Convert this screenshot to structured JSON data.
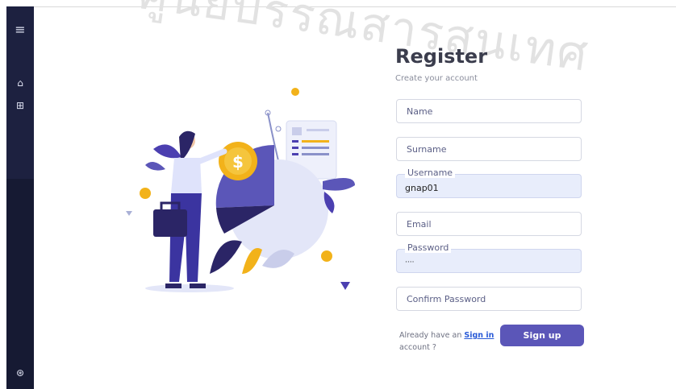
{
  "watermark": "ศูนย์บรรณสารสนเทศ",
  "sidebar": {
    "menu_icon": "≡",
    "home_icon": "⌂",
    "apps_icon": "⊞",
    "user_icon": "⊛"
  },
  "form": {
    "title": "Register",
    "subtitle": "Create your account",
    "name": {
      "placeholder": "Name",
      "value": ""
    },
    "surname": {
      "placeholder": "Surname",
      "value": ""
    },
    "username": {
      "label": "Username",
      "value": "gnap01"
    },
    "email": {
      "placeholder": "Email",
      "value": ""
    },
    "password": {
      "label": "Password",
      "value": "····"
    },
    "confirm_password": {
      "placeholder": "Confirm Password",
      "value": ""
    },
    "already_text": "Already have an",
    "already_text_2": "account ?",
    "signin_link": "Sign in",
    "signup_button": "Sign up"
  },
  "illustration": {
    "coin_symbol": "$"
  },
  "colors": {
    "sidebar_bg": "#161a33",
    "accent": "#5b56b8",
    "link": "#2a5bd7",
    "filled_field": "#e8edfb"
  }
}
